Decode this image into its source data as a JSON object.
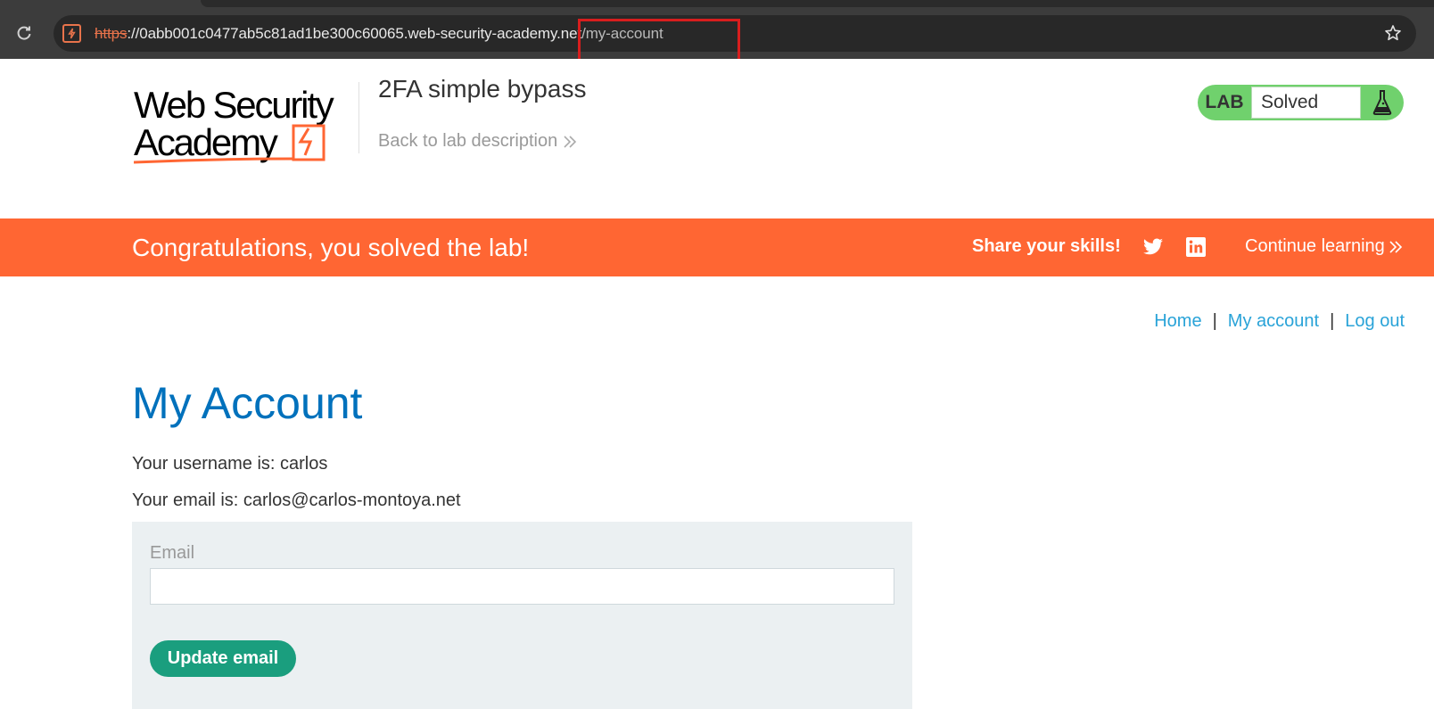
{
  "browser": {
    "url_scheme": "https",
    "url_host": "://0abb001c0477ab5c81ad1be300c60065.web-security-academy.net",
    "url_path": "/my-account",
    "colors": {
      "scheme": "#e8734b",
      "highlight": "#d81e1e"
    }
  },
  "header": {
    "logo_line1": "Web Security",
    "logo_line2": "Academy",
    "lab_title": "2FA simple bypass",
    "back_link": "Back to lab description",
    "lab_badge": "LAB",
    "lab_state": "Solved",
    "colors": {
      "badge_bg": "#70d16d"
    }
  },
  "banner": {
    "message": "Congratulations, you solved the lab!",
    "share_label": "Share your skills!",
    "continue_label": "Continue learning",
    "icons": [
      "twitter-icon",
      "linkedin-icon"
    ],
    "colors": {
      "bg": "#ff6633"
    }
  },
  "nav": {
    "home": "Home",
    "separator": "|",
    "my_account": "My account",
    "log_out": "Log out"
  },
  "account": {
    "title": "My Account",
    "username_line": "Your username is: carlos",
    "email_line": "Your email is: carlos@carlos-montoya.net",
    "email_label": "Email",
    "email_value": "",
    "update_button": "Update email",
    "colors": {
      "title": "#0071bc",
      "button": "#1a9e7e",
      "form_bg": "#ebf0f2"
    }
  }
}
